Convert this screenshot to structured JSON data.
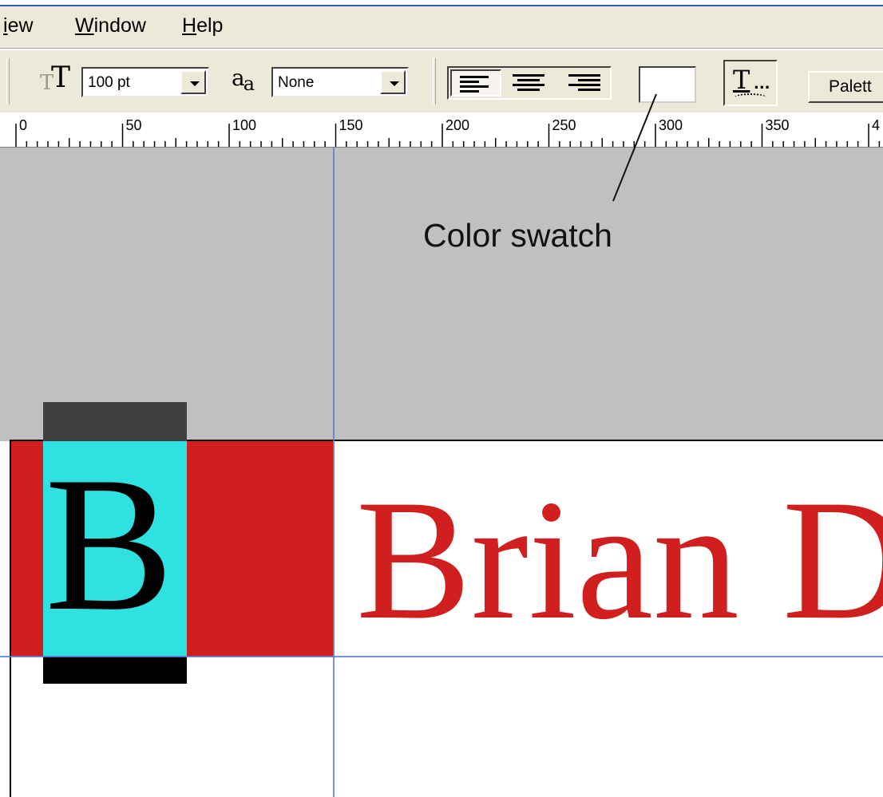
{
  "menubar": {
    "items": [
      {
        "label": "View",
        "visible": "iew",
        "underline_index": 0
      },
      {
        "label": "Window",
        "underline_index": 0
      },
      {
        "label": "Help",
        "underline_index": 0
      }
    ]
  },
  "toolbar": {
    "font_size_value": "100 pt",
    "antialias_value": "None",
    "align_active": "left",
    "swatch_color": "#ffffff",
    "palette_label": "Palett"
  },
  "ruler": {
    "labels": [
      "0",
      "50",
      "100",
      "150",
      "200",
      "250",
      "300",
      "350",
      "4"
    ]
  },
  "annotation": {
    "label": "Color swatch"
  },
  "document": {
    "tile_letter": "B",
    "headline": "Brian D",
    "colors": {
      "red": "#d11f1f",
      "cyan": "#2ee2e2",
      "gray_canvas": "#c0c0c0",
      "guide": "#5b7fd8"
    }
  },
  "icons": [
    "text-size-icon",
    "antialias-icon",
    "align-left-icon",
    "align-center-icon",
    "align-right-icon",
    "text-effects-icon",
    "dropdown-arrow-icon"
  ]
}
